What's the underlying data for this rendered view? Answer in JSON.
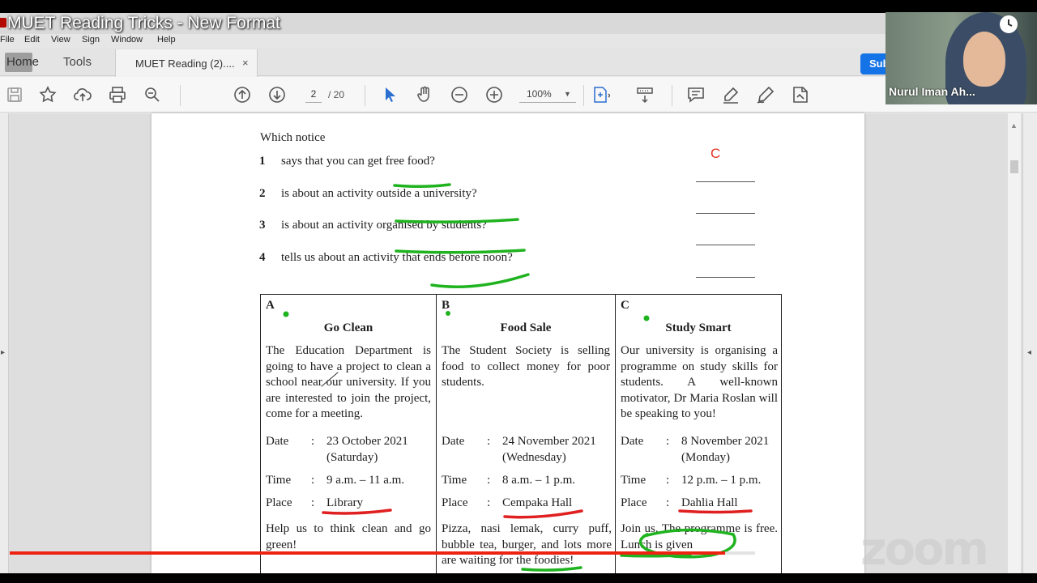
{
  "window": {
    "title": "MUET Reading Tricks - New Format"
  },
  "menu": [
    "File",
    "Edit",
    "View",
    "Sign",
    "Window",
    "Help"
  ],
  "tabs": {
    "home": "Home",
    "tools": "Tools",
    "document": "MUET Reading  (2)....",
    "close": "×"
  },
  "submit_partial": "Sub",
  "toolbar": {
    "page_current": "2",
    "page_separator_total": "/  20",
    "zoom": "100%"
  },
  "icons": [
    "save-icon",
    "bookmark-star-icon",
    "upload-cloud-icon",
    "print-icon",
    "zoom-search-icon",
    "page-up-icon",
    "page-down-icon",
    "select-cursor-icon",
    "hand-tool-icon",
    "zoom-out-icon",
    "zoom-in-icon",
    "fit-page-icon",
    "scroll-mode-icon",
    "comment-icon",
    "highlight-pen-icon",
    "sign-icon",
    "fill-sign-icon",
    "clock-icon"
  ],
  "document": {
    "prompt": "Which notice",
    "questions": [
      {
        "num": "1",
        "text": "says that you can get free food?"
      },
      {
        "num": "2",
        "text": "is about an activity outside a university?"
      },
      {
        "num": "3",
        "text": "is about an activity organised by students?"
      },
      {
        "num": "4",
        "text": "tells us about an activity that ends before noon?"
      }
    ],
    "handwritten_answer": "C",
    "notices": [
      {
        "letter": "A",
        "title": "Go Clean",
        "description": "The Education Department is going to have a project to clean a school near our university. If you are interested to join the project, come for a meeting.",
        "date_label": "Date",
        "date": "23 October 2021",
        "day": "(Saturday)",
        "time_label": "Time",
        "time": "9 a.m. – 11 a.m.",
        "place_label": "Place",
        "place": "Library",
        "footer": "Help us to think clean and go green!"
      },
      {
        "letter": "B",
        "title": "Food Sale",
        "description": "The Student Society is selling food to collect money for poor students.",
        "date_label": "Date",
        "date": "24 November 2021",
        "day": "(Wednesday)",
        "time_label": "Time",
        "time": "8 a.m. – 1 p.m.",
        "place_label": "Place",
        "place": "Cempaka Hall",
        "footer": "Pizza, nasi lemak, curry puff, bubble tea, burger, and lots more are waiting for the foodies!"
      },
      {
        "letter": "C",
        "title": "Study Smart",
        "description": "Our university is organising a programme on study skills for students. A well-known motivator, Dr Maria Roslan will be speaking to you!",
        "date_label": "Date",
        "date": "8 November 2021",
        "day": "(Monday)",
        "time_label": "Time",
        "time": "12 p.m. – 1 p.m.",
        "place_label": "Place",
        "place": "Dahlia Hall",
        "footer": "Join us. The programme is free. Lunch is given"
      }
    ]
  },
  "webcam": {
    "name": "Nurul Iman Ah..."
  },
  "video_progress": 0.96,
  "watermark": "zoom",
  "colors": {
    "annotation_green": "#1fb31f",
    "annotation_red": "#e02020",
    "progress_red": "#e21",
    "acrobat_blue": "#1473e6"
  }
}
